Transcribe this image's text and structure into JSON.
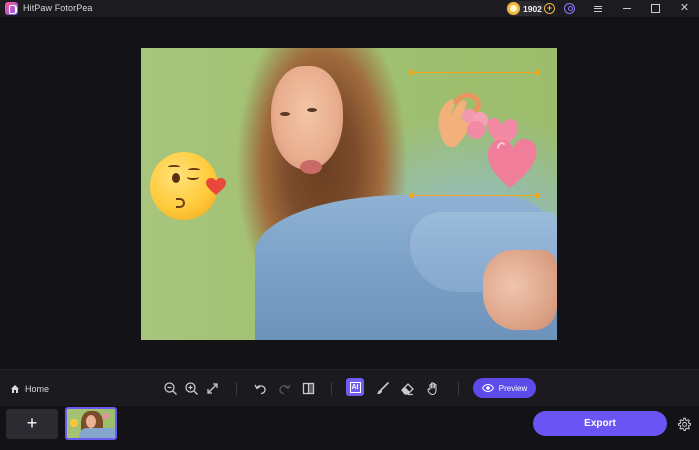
{
  "app": {
    "title": "HitPaw FotorPea"
  },
  "header": {
    "coins": "1902",
    "icons": [
      "app-logo",
      "coin-icon",
      "add-coin-icon",
      "user-icon",
      "menu-icon",
      "minimize-icon",
      "maximize-icon",
      "close-icon"
    ]
  },
  "canvas": {
    "stickers": [
      "kiss-emoji",
      "heart-hands-sticker"
    ],
    "selected_sticker": "heart-hands-sticker"
  },
  "toolbar": {
    "home_label": "Home",
    "ai_label": "AI",
    "preview_label": "Preview",
    "icons": [
      "home-icon",
      "zoom-out-icon",
      "zoom-in-icon",
      "fit-screen-icon",
      "undo-icon",
      "redo-icon",
      "compare-icon",
      "ai-icon",
      "brush-icon",
      "eraser-icon",
      "hand-icon",
      "eye-icon"
    ]
  },
  "footer": {
    "add_label": "+",
    "export_label": "Export"
  },
  "colors": {
    "accent": "#6a55f4",
    "selection": "#f3a51b",
    "coin": "#f3b73b"
  }
}
